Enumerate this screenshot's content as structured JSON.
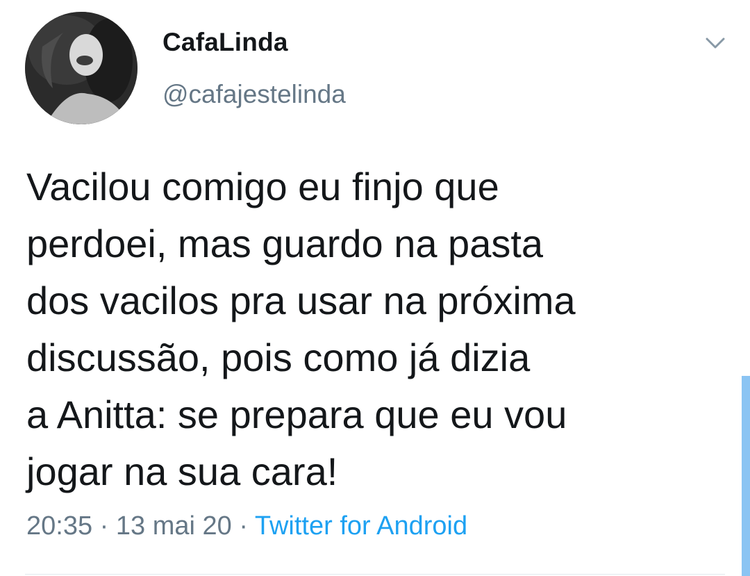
{
  "tweet": {
    "display_name": "CafaLinda",
    "handle": "@cafajestelinda",
    "text_lines": [
      "Vacilou comigo eu finjo que",
      "perdoei, mas guardo na pasta",
      "dos vacilos pra usar na próxima",
      "discussão, pois como já dizia",
      "a Anitta: se prepara que eu vou",
      "jogar na sua cara!"
    ],
    "time": "20:35",
    "date": "13 mai 20",
    "separator": "·",
    "source": "Twitter for Android"
  },
  "icons": {
    "caret": "chevron-down-icon"
  },
  "colors": {
    "text_primary": "#14171a",
    "text_secondary": "#657786",
    "link": "#1da1f2",
    "scroll_indicator": "#8bc4f3"
  }
}
